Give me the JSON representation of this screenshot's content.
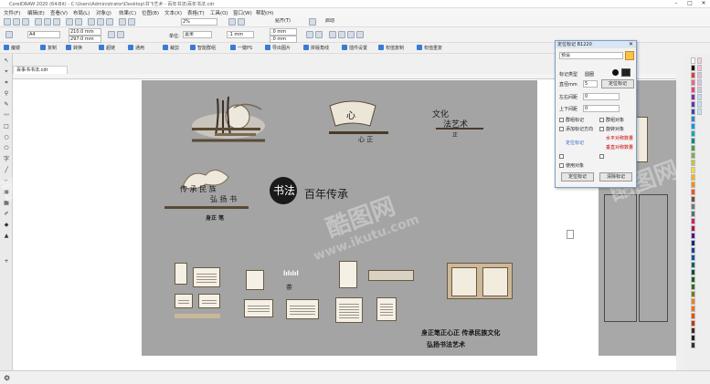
{
  "app": {
    "title": "CorelDRAW 2020 (64-Bit) - C:\\Users\\Administrator\\Desktop\\书飞艺术 - 百年书法\\百年书法.cdr",
    "win_min": "–",
    "win_max": "□",
    "win_close": "✕"
  },
  "menu": [
    "文件(F)",
    "编辑(E)",
    "查看(V)",
    "布局(L)",
    "对象(J)",
    "效果(C)",
    "位图(B)",
    "文本(X)",
    "表格(T)",
    "工具(O)",
    "窗口(W)",
    "帮助(H)"
  ],
  "toolbar": {
    "zoom": "2%",
    "snap": "贴齐(T)",
    "launch": "启动"
  },
  "propbar": {
    "paper": "A4",
    "width": "210.0 mm",
    "height": "297.0 mm",
    "unit_label": "单位:",
    "unit": "毫米",
    "nudge": ".1 mm",
    "dup_x": ".0 mm",
    "dup_y": ".0 mm"
  },
  "plugins": [
    "魔镜",
    "复制",
    "转换",
    "超链",
    "通用",
    "裁剪",
    "智能群组",
    "一键PS",
    "导出图片",
    "拼版角线",
    "插件设置",
    "权值复制",
    "权值重复"
  ],
  "document": {
    "tab": "百事书书法.cdr"
  },
  "artwork": {
    "culture_1": "文化",
    "culture_2": "法艺术",
    "zheng": "正",
    "xin_zheng": "心  正",
    "heritage_1": "传 承 民 族",
    "heritage_2": "弘 扬 书",
    "body_pen": "身正    笔",
    "seal_big": "书法",
    "centennial": "百年传承",
    "slogan_1": "身正笔正心正     传承民族文化",
    "slogan_2": "弘扬书法艺术",
    "tea_small": "茶",
    "bars": "lılılıl"
  },
  "watermark": {
    "site": "www.ikutu.com",
    "logo": "酷图网"
  },
  "dialog": {
    "title": "定位标记 B1220",
    "preset": "预设",
    "mark_type": "标记类型",
    "mark_type_val": "圆圈",
    "diameter_label": "直径mm",
    "diameter": "5",
    "apply_label": "定位标记",
    "lr_label": "左右间距",
    "lr": "0",
    "tb_label": "上下间距",
    "tb": "0",
    "opt1": "群组标记",
    "opt2": "添加标记方向",
    "opt3": "群组对象",
    "opt4": "旋转对象",
    "opt5": "水平对称数量",
    "opt6": "垂直对称数量",
    "opt7": "定位标记",
    "opt8": "使用对象",
    "btn_ok": "定位标记",
    "btn_clear": "清除标记",
    "dropdown_arrow": "▾"
  },
  "palette": [
    "#ffffff",
    "#000000",
    "#e53935",
    "#f06292",
    "#ec407a",
    "#8e24aa",
    "#5e35b1",
    "#3949ab",
    "#1e88e5",
    "#039be5",
    "#00acc1",
    "#00897b",
    "#43a047",
    "#7cb342",
    "#c0ca33",
    "#fdd835",
    "#ffb300",
    "#fb8c00",
    "#f4511e",
    "#6d4c41",
    "#757575",
    "#546e7a",
    "#d81b60",
    "#ad1457",
    "#4a148c",
    "#1a237e",
    "#0d47a1",
    "#01579b",
    "#006064",
    "#004d40",
    "#1b5e20",
    "#33691e",
    "#827717",
    "#f57f17",
    "#ff6f00",
    "#e65100",
    "#bf360c",
    "#3e2723",
    "#212121",
    "#263238",
    "#ffcdd2",
    "#f8bbd0",
    "#e1bee7",
    "#d1c4e9",
    "#c5cae9",
    "#bbdefb",
    "#b3e5fc",
    "#b2ebf2"
  ],
  "status": {
    "icon": "gear-icon"
  }
}
